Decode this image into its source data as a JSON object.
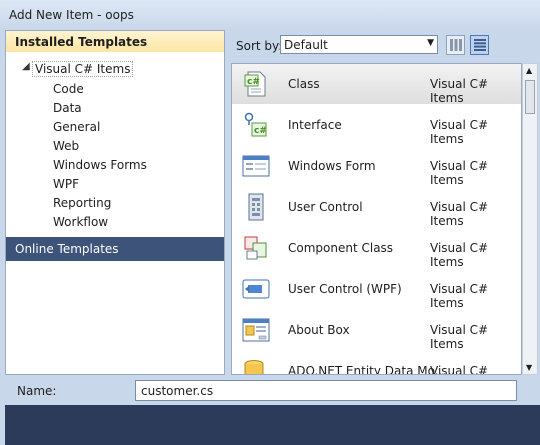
{
  "window": {
    "title": "Add New Item - oops"
  },
  "left_pane": {
    "installed_header": "Installed Templates",
    "tree_root": "Visual C# Items",
    "tree_children": [
      "Code",
      "Data",
      "General",
      "Web",
      "Windows Forms",
      "WPF",
      "Reporting",
      "Workflow"
    ],
    "online_header": "Online Templates"
  },
  "sort": {
    "label": "Sort by:",
    "value": "Default"
  },
  "view_buttons": [
    {
      "icon": "medium-icons-view-icon",
      "active": false
    },
    {
      "icon": "list-view-icon",
      "active": true
    }
  ],
  "items": [
    {
      "name": "Class",
      "type": "Visual C# Items",
      "icon": "class-icon",
      "selected": true
    },
    {
      "name": "Interface",
      "type": "Visual C# Items",
      "icon": "interface-icon",
      "selected": false
    },
    {
      "name": "Windows Form",
      "type": "Visual C# Items",
      "icon": "windows-form-icon",
      "selected": false
    },
    {
      "name": "User Control",
      "type": "Visual C# Items",
      "icon": "user-control-icon",
      "selected": false
    },
    {
      "name": "Component Class",
      "type": "Visual C# Items",
      "icon": "component-class-icon",
      "selected": false
    },
    {
      "name": "User Control (WPF)",
      "type": "Visual C# Items",
      "icon": "wpf-user-control-icon",
      "selected": false
    },
    {
      "name": "About Box",
      "type": "Visual C# Items",
      "icon": "about-box-icon",
      "selected": false
    },
    {
      "name": "ADO.NET Entity Data Mo...",
      "type": "Visual C# Items",
      "icon": "entity-data-model-icon",
      "selected": false
    }
  ],
  "name_field": {
    "label": "Name:",
    "value": "customer.cs"
  },
  "colors": {
    "accent": "#3d5379",
    "header_gold": "#fde5a3",
    "window_bg": "#c9d7ea"
  }
}
